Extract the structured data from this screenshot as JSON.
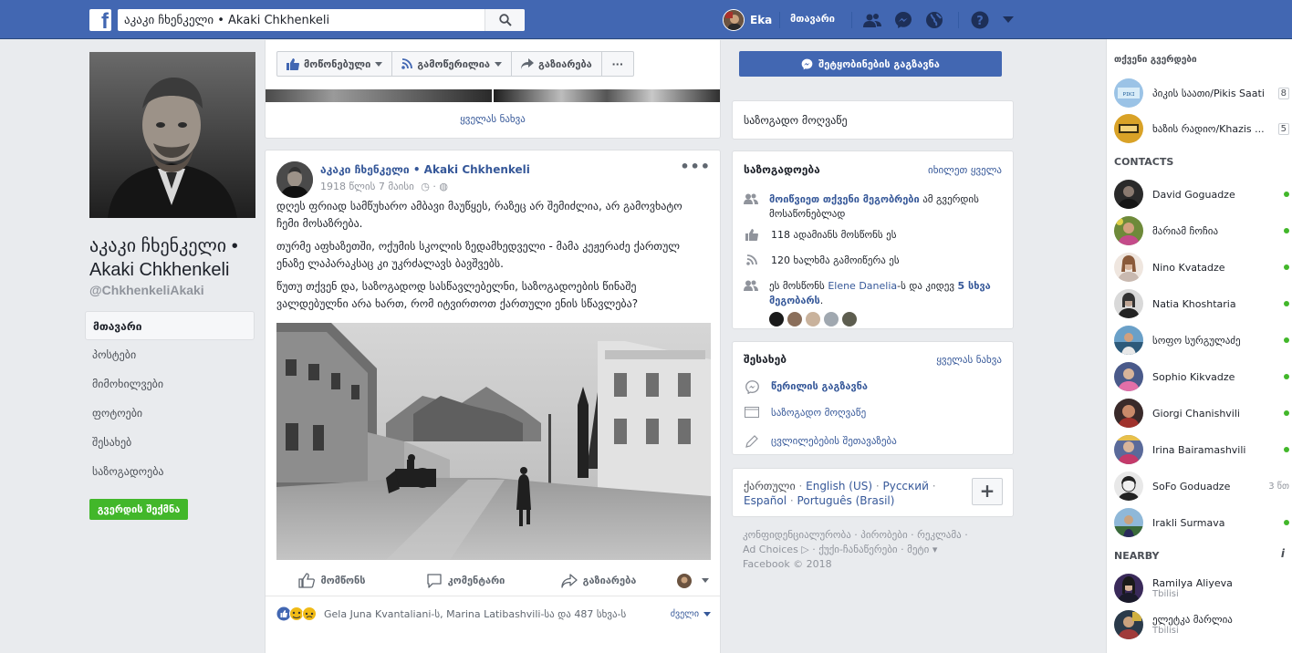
{
  "topbar": {
    "search_value": "აკაკი ჩხენკელი • Akaki Chkhenkeli",
    "user_name": "Eka",
    "home_label": "მთავარი"
  },
  "profile": {
    "name": "აკაკი ჩხენკელი • Akaki Chkhenkeli",
    "handle": "@ChkhenkeliAkaki",
    "nav": [
      "მთავარი",
      "პოსტები",
      "მიმოხილვები",
      "ფოტოები",
      "შესახებ",
      "საზოგადოება"
    ],
    "create_page_label": "გვერდის შექმნა"
  },
  "action_bar": {
    "liked_label": "მოწონებული",
    "following_label": "გამოწერილია",
    "share_label": "გაზიარება",
    "more_label": "···",
    "send_message_label": "შეტყობინების გაგზავნა"
  },
  "photos_card": {
    "see_all": "ყველას ნახვა"
  },
  "post": {
    "author": "აკაკი ჩხენკელი • Akaki Chkhenkeli",
    "date": "1918 წლის 7 მაისი",
    "paragraphs": [
      "დღეს ფრიად სამწუხარო ამბავი მაუწყეს, რაზეც არ შემიძლია, არ გამოვხატო ჩემი მოსაზრება.",
      "თურმე აფხაზეთში, ოქუმის სკოლის ზედამხედველი - მამა კეჟერაძე ქართულ ენაზე ლაპარაკსაც კი უკრძალავს ბავშვებს.",
      "წუთუ თქვენ და, საზოგადოდ სასწავლებელნი, საზოგადოების წინაშე ვალდებულნი არა ხართ, რომ იტვირთოთ ქართული ენის სწავლება?"
    ],
    "like_label": "მომწონს",
    "comment_label": "კომენტარი",
    "share_label": "გაზიარება",
    "reactions_text": "Gela Juna Kvantaliani-ს, Marina Latibashvili-სა და 487 სხვა-ს",
    "sort_label": "ძველი"
  },
  "public_figure_card": {
    "label": "საზოგადო მოღვაწე"
  },
  "community": {
    "title": "საზოგადოება",
    "see_all": "იხილეთ ყველა",
    "invite_link": "მოიწვიეთ თქვენი მეგობრები",
    "invite_rest": "ამ გვერდის მოსაწონებლად",
    "likes_text": "118 ადამიანს მოსწონს ეს",
    "follows_text": "120 ხალხმა გამოიწერა ეს",
    "friends_prefix": "ეს მოსწონს",
    "friends_name": "Elene Danelia",
    "friends_mid": "-ს და კიდევ",
    "friends_more": "5 სხვა მეგობარს",
    "friends_end": "."
  },
  "about": {
    "title": "შესახებ",
    "see_all": "ყველას ნახვა",
    "message_label": "წერილის გაგზავნა",
    "category": "საზოგადო მოღვაწე",
    "suggest_edits": "ცვლილებების შეთავაზება"
  },
  "languages": {
    "items": [
      "ქართული",
      "English (US)",
      "Русский",
      "Español",
      "Português (Brasil)"
    ],
    "add_label": "+"
  },
  "footer": {
    "line1": "კონფიდენციალურობა · პირობები · რეკლამა ·",
    "line2": "Ad Choices ▷ · ქუქი-ჩანაწერები · მეტი ▾",
    "copyright": "Facebook © 2018"
  },
  "chat": {
    "pages_header": "თქვენი გვერდები",
    "pages": [
      {
        "name": "პიკის საათი/Pikis Saati",
        "count": "8"
      },
      {
        "name": "ხაზის რადიო/Khazis ...",
        "count": "5"
      }
    ],
    "contacts_header": "CONTACTS",
    "contacts": [
      {
        "name": "David Goguadze",
        "meta": ""
      },
      {
        "name": "მარიამ ჩოჩია",
        "meta": ""
      },
      {
        "name": "Nino Kvatadze",
        "meta": ""
      },
      {
        "name": "Natia Khoshtaria",
        "meta": ""
      },
      {
        "name": "სოფო სურგულაძე",
        "meta": ""
      },
      {
        "name": "Sophio Kikvadze",
        "meta": ""
      },
      {
        "name": "Giorgi Chanishvili",
        "meta": ""
      },
      {
        "name": "Irina Bairamashvili",
        "meta": ""
      },
      {
        "name": "SoFo Goduadze",
        "meta": "3 წთ"
      },
      {
        "name": "Irakli Surmava",
        "meta": ""
      }
    ],
    "nearby_header": "NEARBY",
    "nearby": [
      {
        "name": "Ramilya Aliyeva",
        "sub": "Tbilisi"
      },
      {
        "name": "ელეტკა მარლია",
        "sub": "Tbilisi"
      }
    ]
  },
  "colors": {
    "brand": "#4267b2",
    "link": "#365899",
    "green": "#42b72a"
  }
}
